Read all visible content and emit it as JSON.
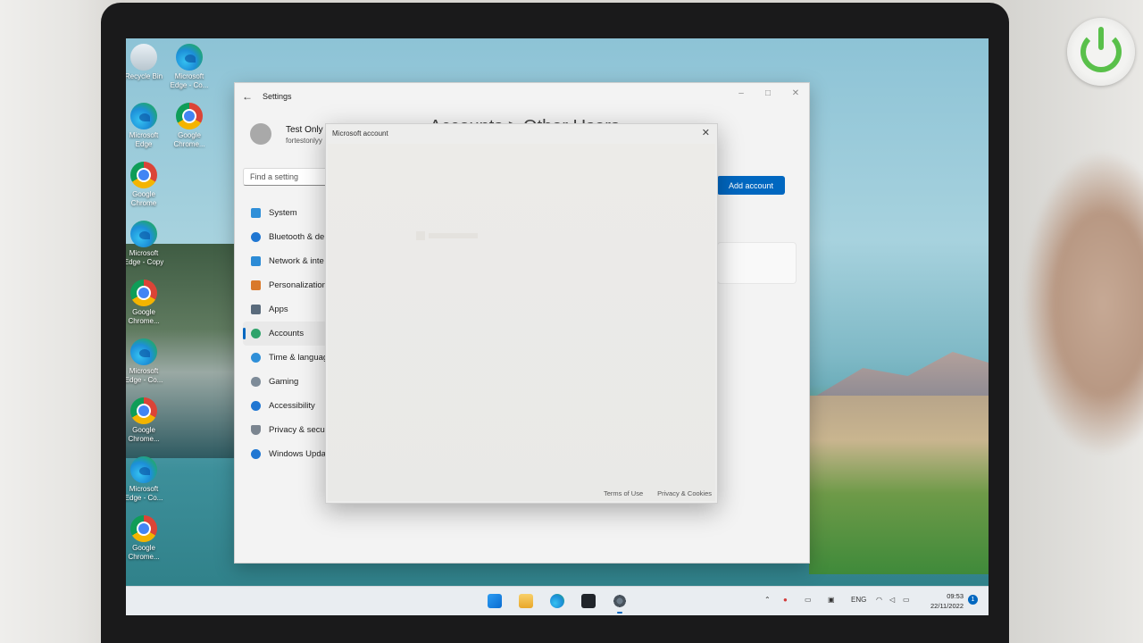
{
  "desktop": {
    "icons": [
      {
        "label": "Recycle Bin",
        "icon": "recycle-bin-icon"
      },
      {
        "label": "Microsoft Edge - Co...",
        "icon": "edge-icon"
      },
      {
        "label": "Microsoft Edge",
        "icon": "edge-icon"
      },
      {
        "label": "Google Chrome...",
        "icon": "chrome-icon"
      },
      {
        "label": "Google Chrome",
        "icon": "chrome-icon"
      },
      {
        "label": "Microsoft Edge - Copy",
        "icon": "edge-icon"
      },
      {
        "label": "Google Chrome...",
        "icon": "chrome-icon"
      },
      {
        "label": "Microsoft Edge - Co...",
        "icon": "edge-icon"
      },
      {
        "label": "Google Chrome...",
        "icon": "chrome-icon"
      },
      {
        "label": "Microsoft Edge - Co...",
        "icon": "edge-icon"
      },
      {
        "label": "Google Chrome...",
        "icon": "chrome-icon"
      }
    ]
  },
  "settings": {
    "title": "Settings",
    "user": {
      "name": "Test Only",
      "email": "fortestonlyy"
    },
    "search_placeholder": "Find a setting",
    "heading_peek": "Accounts  >  Other Users",
    "add_account_label": "Add account",
    "nav": [
      {
        "label": "System",
        "icon": "system-icon",
        "color": "#2f8fd8"
      },
      {
        "label": "Bluetooth & de",
        "icon": "bluetooth-icon",
        "color": "#1f76d2"
      },
      {
        "label": "Network & inte",
        "icon": "network-icon",
        "color": "#2c8bd6"
      },
      {
        "label": "Personalization",
        "icon": "brush-icon",
        "color": "#d9792b"
      },
      {
        "label": "Apps",
        "icon": "apps-icon",
        "color": "#5a6b7c"
      },
      {
        "label": "Accounts",
        "icon": "person-icon",
        "color": "#2fa36b"
      },
      {
        "label": "Time & languag",
        "icon": "globe-icon",
        "color": "#2f8fd8"
      },
      {
        "label": "Gaming",
        "icon": "gamepad-icon",
        "color": "#7d8b98"
      },
      {
        "label": "Accessibility",
        "icon": "accessibility-icon",
        "color": "#1f76d2"
      },
      {
        "label": "Privacy & secur",
        "icon": "shield-icon",
        "color": "#7b8590"
      },
      {
        "label": "Windows Upda",
        "icon": "update-icon",
        "color": "#1f76d2"
      }
    ],
    "active_nav": "Accounts"
  },
  "dialog": {
    "title": "Microsoft account",
    "links": {
      "terms": "Terms of Use",
      "privacy": "Privacy & Cookies"
    }
  },
  "taskbar": {
    "language": "ENG",
    "time": "09:53",
    "date": "22/11/2022",
    "notification_count": "1"
  }
}
